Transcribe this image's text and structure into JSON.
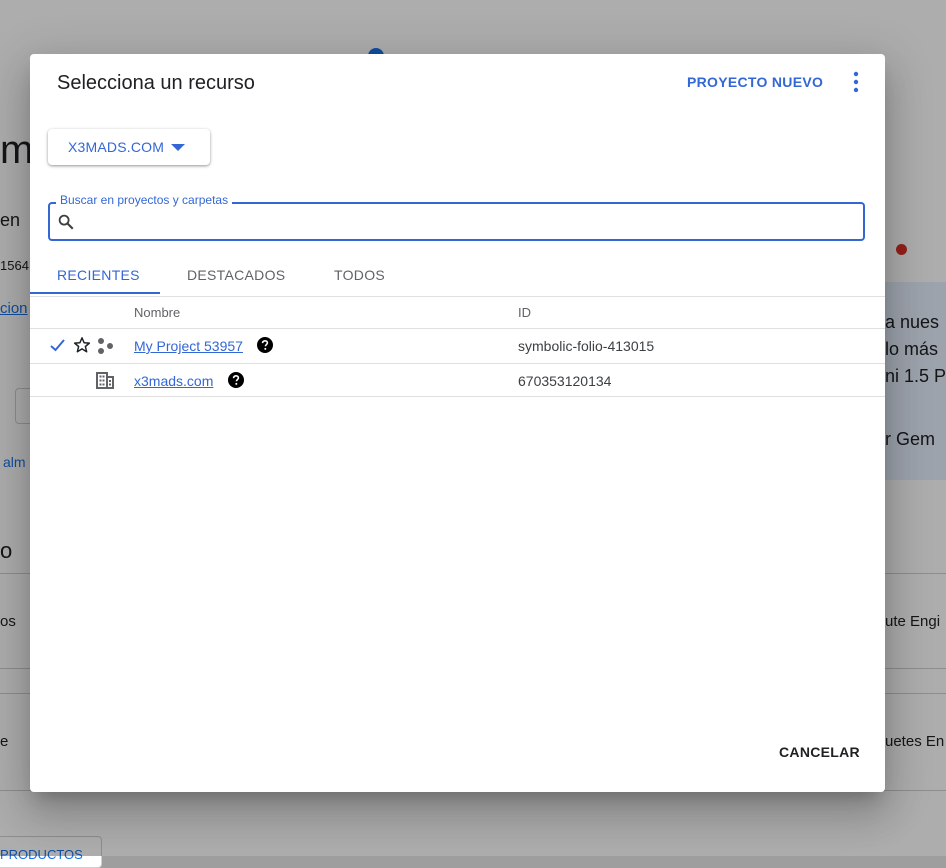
{
  "background": {
    "fragments": [
      "m",
      "en",
      "1564",
      "cion",
      "alm",
      "o",
      "os",
      "e",
      "a nues",
      "lo más",
      "ni 1.5 P",
      "r Gem",
      "ute Engi",
      "uetes En",
      "PRODUCTOS"
    ]
  },
  "dialog": {
    "title": "Selecciona un recurso",
    "new_project_label": "PROYECTO NUEVO",
    "org_selector": {
      "label": "X3MADS.COM"
    },
    "search": {
      "label": "Buscar en proyectos y carpetas",
      "value": "",
      "placeholder": ""
    },
    "tabs": [
      {
        "label": "RECIENTES",
        "active": true
      },
      {
        "label": "DESTACADOS",
        "active": false
      },
      {
        "label": "TODOS",
        "active": false
      }
    ],
    "table": {
      "columns": [
        "Nombre",
        "ID"
      ],
      "rows": [
        {
          "selected": true,
          "icons": [
            "check-icon",
            "star-outline-icon",
            "project-nodes-icon",
            "help-icon"
          ],
          "name": "My Project 53957",
          "id": "symbolic-folio-413015"
        },
        {
          "selected": false,
          "icons": [
            "organization-building-icon",
            "help-icon"
          ],
          "name": "x3mads.com",
          "id": "670353120134"
        }
      ]
    },
    "cancel_label": "CANCELAR"
  },
  "colors": {
    "accent": "#3367d6",
    "overlay": "rgba(0,0,0,0.32)"
  }
}
